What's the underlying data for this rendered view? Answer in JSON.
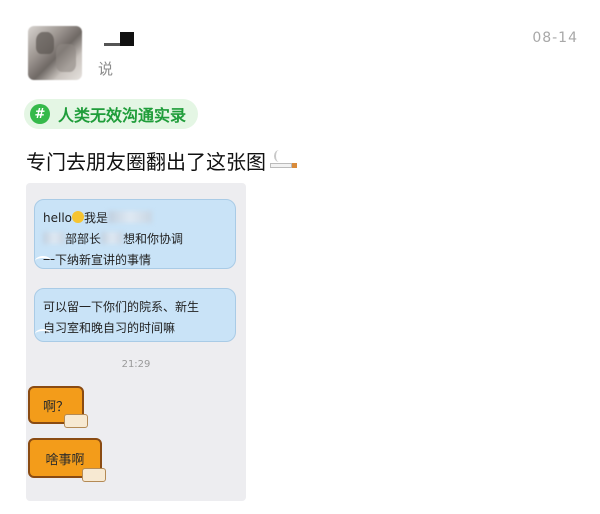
{
  "post": {
    "verb": "说",
    "date": "08-14",
    "topic": "人类无效沟通实录",
    "topic_icon": "#",
    "text": "专门去朋友圈翻出了这张图"
  },
  "chat": {
    "bubble1": {
      "p1": "hello",
      "p2": "我是",
      "p3": "部部长",
      "p4": "想和你协调",
      "p5": "一下纳新宣讲的事情"
    },
    "bubble2": {
      "line1": "可以留一下你们的院系、新生",
      "line2": "自习室和晚自习的时间嘛"
    },
    "time": "21:29",
    "sticker1": "啊？",
    "sticker2": "啥事啊"
  },
  "colors": {
    "topic_green": "#1f9d3a",
    "bubble_blue": "#c9e3f7",
    "sticker_orange": "#f39c1a"
  }
}
